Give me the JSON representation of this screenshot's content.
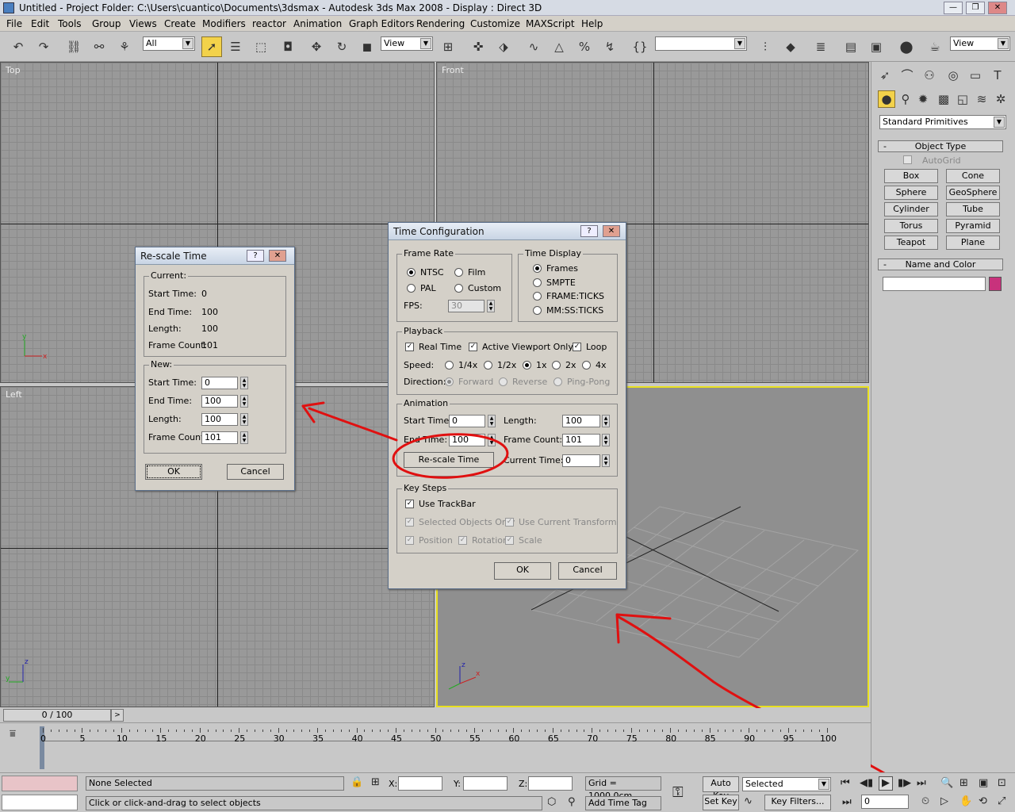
{
  "window": {
    "title": "Untitled     - Project Folder: C:\\Users\\cuantico\\Documents\\3dsmax     - Autodesk 3ds Max 2008     - Display : Direct 3D"
  },
  "menu": [
    "File",
    "Edit",
    "Tools",
    "Group",
    "Views",
    "Create",
    "Modifiers",
    "reactor",
    "Animation",
    "Graph Editors",
    "Rendering",
    "Customize",
    "MAXScript",
    "Help"
  ],
  "toolbar": {
    "selection_filter": "All",
    "ref_coord": "View",
    "named_sel": "",
    "render_view": "View"
  },
  "viewports": {
    "top": "Top",
    "front": "Front",
    "left": "Left"
  },
  "command_panel": {
    "category": "Standard Primitives",
    "object_type_header": "Object Type",
    "autogrid": "AutoGrid",
    "buttons": [
      "Box",
      "Cone",
      "Sphere",
      "GeoSphere",
      "Cylinder",
      "Tube",
      "Torus",
      "Pyramid",
      "Teapot",
      "Plane"
    ],
    "name_color_header": "Name and Color",
    "name_value": "",
    "object_color": "#c8327c"
  },
  "rescale": {
    "title": "Re-scale Time",
    "help": "?",
    "current_label": "Current:",
    "current": [
      {
        "label": "Start Time:",
        "value": "0"
      },
      {
        "label": "End Time:",
        "value": "100"
      },
      {
        "label": "Length:",
        "value": "100"
      },
      {
        "label": "Frame Count:",
        "value": "101"
      }
    ],
    "new_label": "New:",
    "new": [
      {
        "label": "Start Time:",
        "value": "0"
      },
      {
        "label": "End Time:",
        "value": "100"
      },
      {
        "label": "Length:",
        "value": "100"
      },
      {
        "label": "Frame Count:",
        "value": "101"
      }
    ],
    "ok": "OK",
    "cancel": "Cancel"
  },
  "timecfg": {
    "title": "Time Configuration",
    "help": "?",
    "frame_rate": {
      "label": "Frame Rate",
      "ntsc": "NTSC",
      "film": "Film",
      "pal": "PAL",
      "custom": "Custom",
      "fps_label": "FPS:",
      "fps": "30"
    },
    "time_display": {
      "label": "Time Display",
      "opts": [
        "Frames",
        "SMPTE",
        "FRAME:TICKS",
        "MM:SS:TICKS"
      ]
    },
    "playback": {
      "label": "Playback",
      "real_time": "Real Time",
      "active_vp": "Active Viewport Only",
      "loop": "Loop",
      "speed_label": "Speed:",
      "speeds": [
        "1/4x",
        "1/2x",
        "1x",
        "2x",
        "4x"
      ],
      "direction_label": "Direction:",
      "forward": "Forward",
      "reverse": "Reverse",
      "pingpong": "Ping-Pong"
    },
    "animation": {
      "label": "Animation",
      "start_label": "Start Time:",
      "start": "0",
      "end_label": "End Time:",
      "end": "100",
      "length_label": "Length:",
      "length": "100",
      "fc_label": "Frame Count:",
      "fc": "101",
      "rescale": "Re-scale Time",
      "current_label": "Current Time:",
      "current": "0"
    },
    "key_steps": {
      "label": "Key Steps",
      "use_trackbar": "Use TrackBar",
      "sel_only": "Selected Objects Only",
      "use_current": "Use Current Transform",
      "position": "Position",
      "rotation": "Rotation",
      "scale": "Scale"
    },
    "ok": "OK",
    "cancel": "Cancel"
  },
  "timeline": {
    "slider": "0 / 100",
    "ticks": [
      "0",
      "5",
      "10",
      "15",
      "20",
      "25",
      "30",
      "35",
      "40",
      "45",
      "50",
      "55",
      "60",
      "65",
      "70",
      "75",
      "80",
      "85",
      "90",
      "95",
      "100"
    ]
  },
  "status": {
    "selection": "None Selected",
    "prompt": "Click or click-and-drag to select objects",
    "x_label": "X:",
    "y_label": "Y:",
    "z_label": "Z:",
    "x": "",
    "y": "",
    "z": "",
    "grid": "Grid = 1000,0cm",
    "add_time_tag": "Add Time Tag",
    "auto_key": "Auto Key",
    "set_key": "Set Key",
    "key_mode": "Selected",
    "key_filters": "Key Filters...",
    "frame": "0"
  }
}
